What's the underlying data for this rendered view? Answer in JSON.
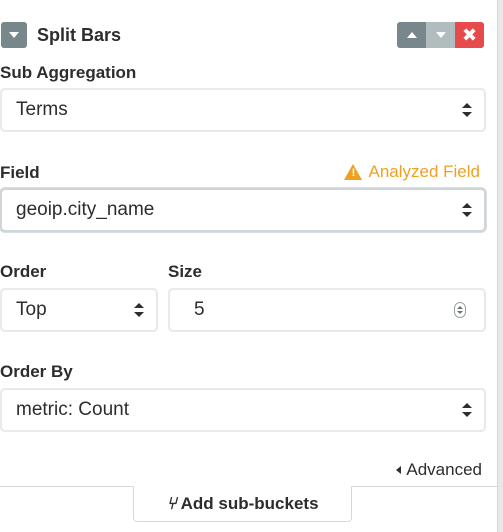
{
  "header": {
    "title": "Split Bars",
    "remove_label": "✖"
  },
  "sub_aggregation": {
    "label": "Sub Aggregation",
    "value": "Terms"
  },
  "field": {
    "label": "Field",
    "warning": "Analyzed Field",
    "value": "geoip.city_name"
  },
  "order": {
    "label": "Order",
    "value": "Top"
  },
  "size": {
    "label": "Size",
    "value": "5"
  },
  "order_by": {
    "label": "Order By",
    "value": "metric: Count"
  },
  "advanced_label": "Advanced",
  "add_sub_buckets_label": "Add sub-buckets",
  "colors": {
    "warning": "#f0a021",
    "remove": "#e64a4a",
    "control": "#78878b"
  }
}
